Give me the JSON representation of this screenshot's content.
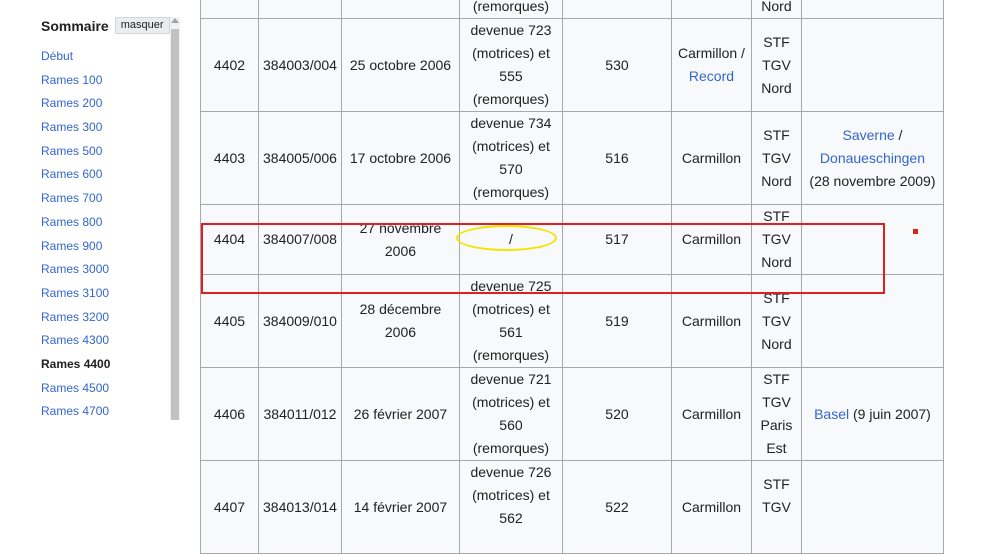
{
  "toc": {
    "title": "Sommaire",
    "hide_label": "masquer",
    "items": [
      "Début",
      "Rames 100",
      "Rames 200",
      "Rames 300",
      "Rames 500",
      "Rames 600",
      "Rames 700",
      "Rames 800",
      "Rames 900",
      "Rames 3000",
      "Rames 3100",
      "Rames 3200",
      "Rames 4300",
      "Rames 4400",
      "Rames 4500",
      "Rames 4700"
    ],
    "current_item": "Rames 4400"
  },
  "table": {
    "prev_row_tail": {
      "note": "(remorques)",
      "depot": "Nord"
    },
    "rows": [
      {
        "id": "4402",
        "series": "384003/004",
        "date": "25 octobre 2006",
        "note": [
          "devenue 723",
          "(motrices) et 555",
          "(remorques)"
        ],
        "num": "530",
        "owner": "Carmillon /",
        "owner_link": "Record",
        "depot": [
          "STF",
          "TGV",
          "Nord"
        ],
        "name": "",
        "name_link": "",
        "name_date": ""
      },
      {
        "id": "4403",
        "series": "384005/006",
        "date": "17 octobre 2006",
        "note": [
          "devenue 734",
          "(motrices) et 570",
          "(remorques)"
        ],
        "num": "516",
        "owner": "Carmillon",
        "owner_link": "",
        "depot": [
          "STF",
          "TGV",
          "Nord"
        ],
        "name": "Donaueschingen",
        "name_link": "Saverne",
        "name_sep": " /",
        "name_date": "(28 novembre 2009)"
      },
      {
        "id": "4404",
        "series": "384007/008",
        "date": "27 novembre 2006",
        "note": [
          "/"
        ],
        "num": "517",
        "owner": "Carmillon",
        "owner_link": "",
        "depot": [
          "STF",
          "TGV",
          "Nord"
        ],
        "name": "",
        "name_link": "",
        "name_date": ""
      },
      {
        "id": "4405",
        "series": "384009/010",
        "date": "28 décembre 2006",
        "note": [
          "devenue 725",
          "(motrices) et 561",
          "(remorques)"
        ],
        "num": "519",
        "owner": "Carmillon",
        "owner_link": "",
        "depot": [
          "STF",
          "TGV",
          "Nord"
        ],
        "name": "",
        "name_link": "",
        "name_date": ""
      },
      {
        "id": "4406",
        "series": "384011/012",
        "date": "26 février 2007",
        "note": [
          "devenue 721",
          "(motrices) et 560",
          "(remorques)"
        ],
        "num": "520",
        "owner": "Carmillon",
        "owner_link": "",
        "depot": [
          "STF",
          "TGV",
          "Paris",
          "Est"
        ],
        "name_link": "Basel",
        "name_date": " (9 juin 2007)"
      },
      {
        "id": "4407",
        "series": "384013/014",
        "date": "14 février 2007",
        "note": [
          "devenue 726",
          "(motrices) et 562"
        ],
        "num": "522",
        "owner": "Carmillon",
        "owner_link": "",
        "depot": [
          "STF",
          "TGV"
        ],
        "name": "",
        "name_link": "",
        "name_date": ""
      }
    ]
  },
  "annotations": {
    "highlight_color": "#e02020",
    "circle_color": "#f2e600"
  }
}
